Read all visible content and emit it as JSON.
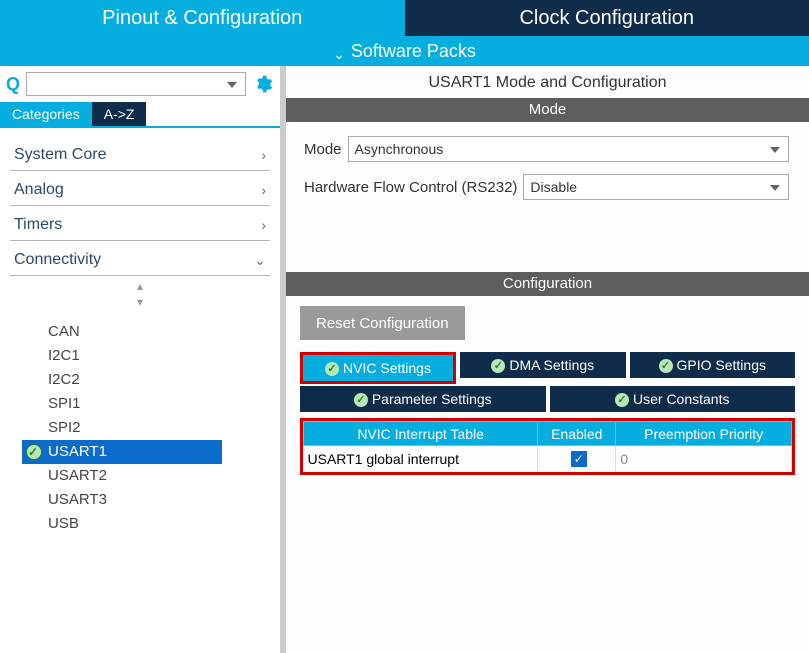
{
  "top_tabs": {
    "pinout": "Pinout & Configuration",
    "clock": "Clock Configuration"
  },
  "packs_label": "Software Packs",
  "sort_tabs": {
    "categories": "Categories",
    "az": "A->Z"
  },
  "tree": {
    "groups": [
      {
        "label": "System Core",
        "expanded": false
      },
      {
        "label": "Analog",
        "expanded": false
      },
      {
        "label": "Timers",
        "expanded": false
      },
      {
        "label": "Connectivity",
        "expanded": true
      }
    ],
    "connectivity_items": [
      "CAN",
      "I2C1",
      "I2C2",
      "SPI1",
      "SPI2",
      "USART1",
      "USART2",
      "USART3",
      "USB"
    ],
    "selected": "USART1"
  },
  "right": {
    "title": "USART1 Mode and Configuration",
    "mode_section": "Mode",
    "mode_label": "Mode",
    "mode_value": "Asynchronous",
    "hwfc_label": "Hardware Flow Control (RS232)",
    "hwfc_value": "Disable",
    "conf_section": "Configuration",
    "reset_btn": "Reset Configuration",
    "tabs": {
      "nvic": "NVIC Settings",
      "dma": "DMA Settings",
      "gpio": "GPIO Settings",
      "param": "Parameter Settings",
      "user": "User Constants"
    },
    "table": {
      "col_int": "NVIC Interrupt Table",
      "col_en": "Enabled",
      "col_pri": "Preemption Priority",
      "rows": [
        {
          "name": "USART1 global interrupt",
          "enabled": true,
          "priority": "0"
        }
      ]
    }
  }
}
